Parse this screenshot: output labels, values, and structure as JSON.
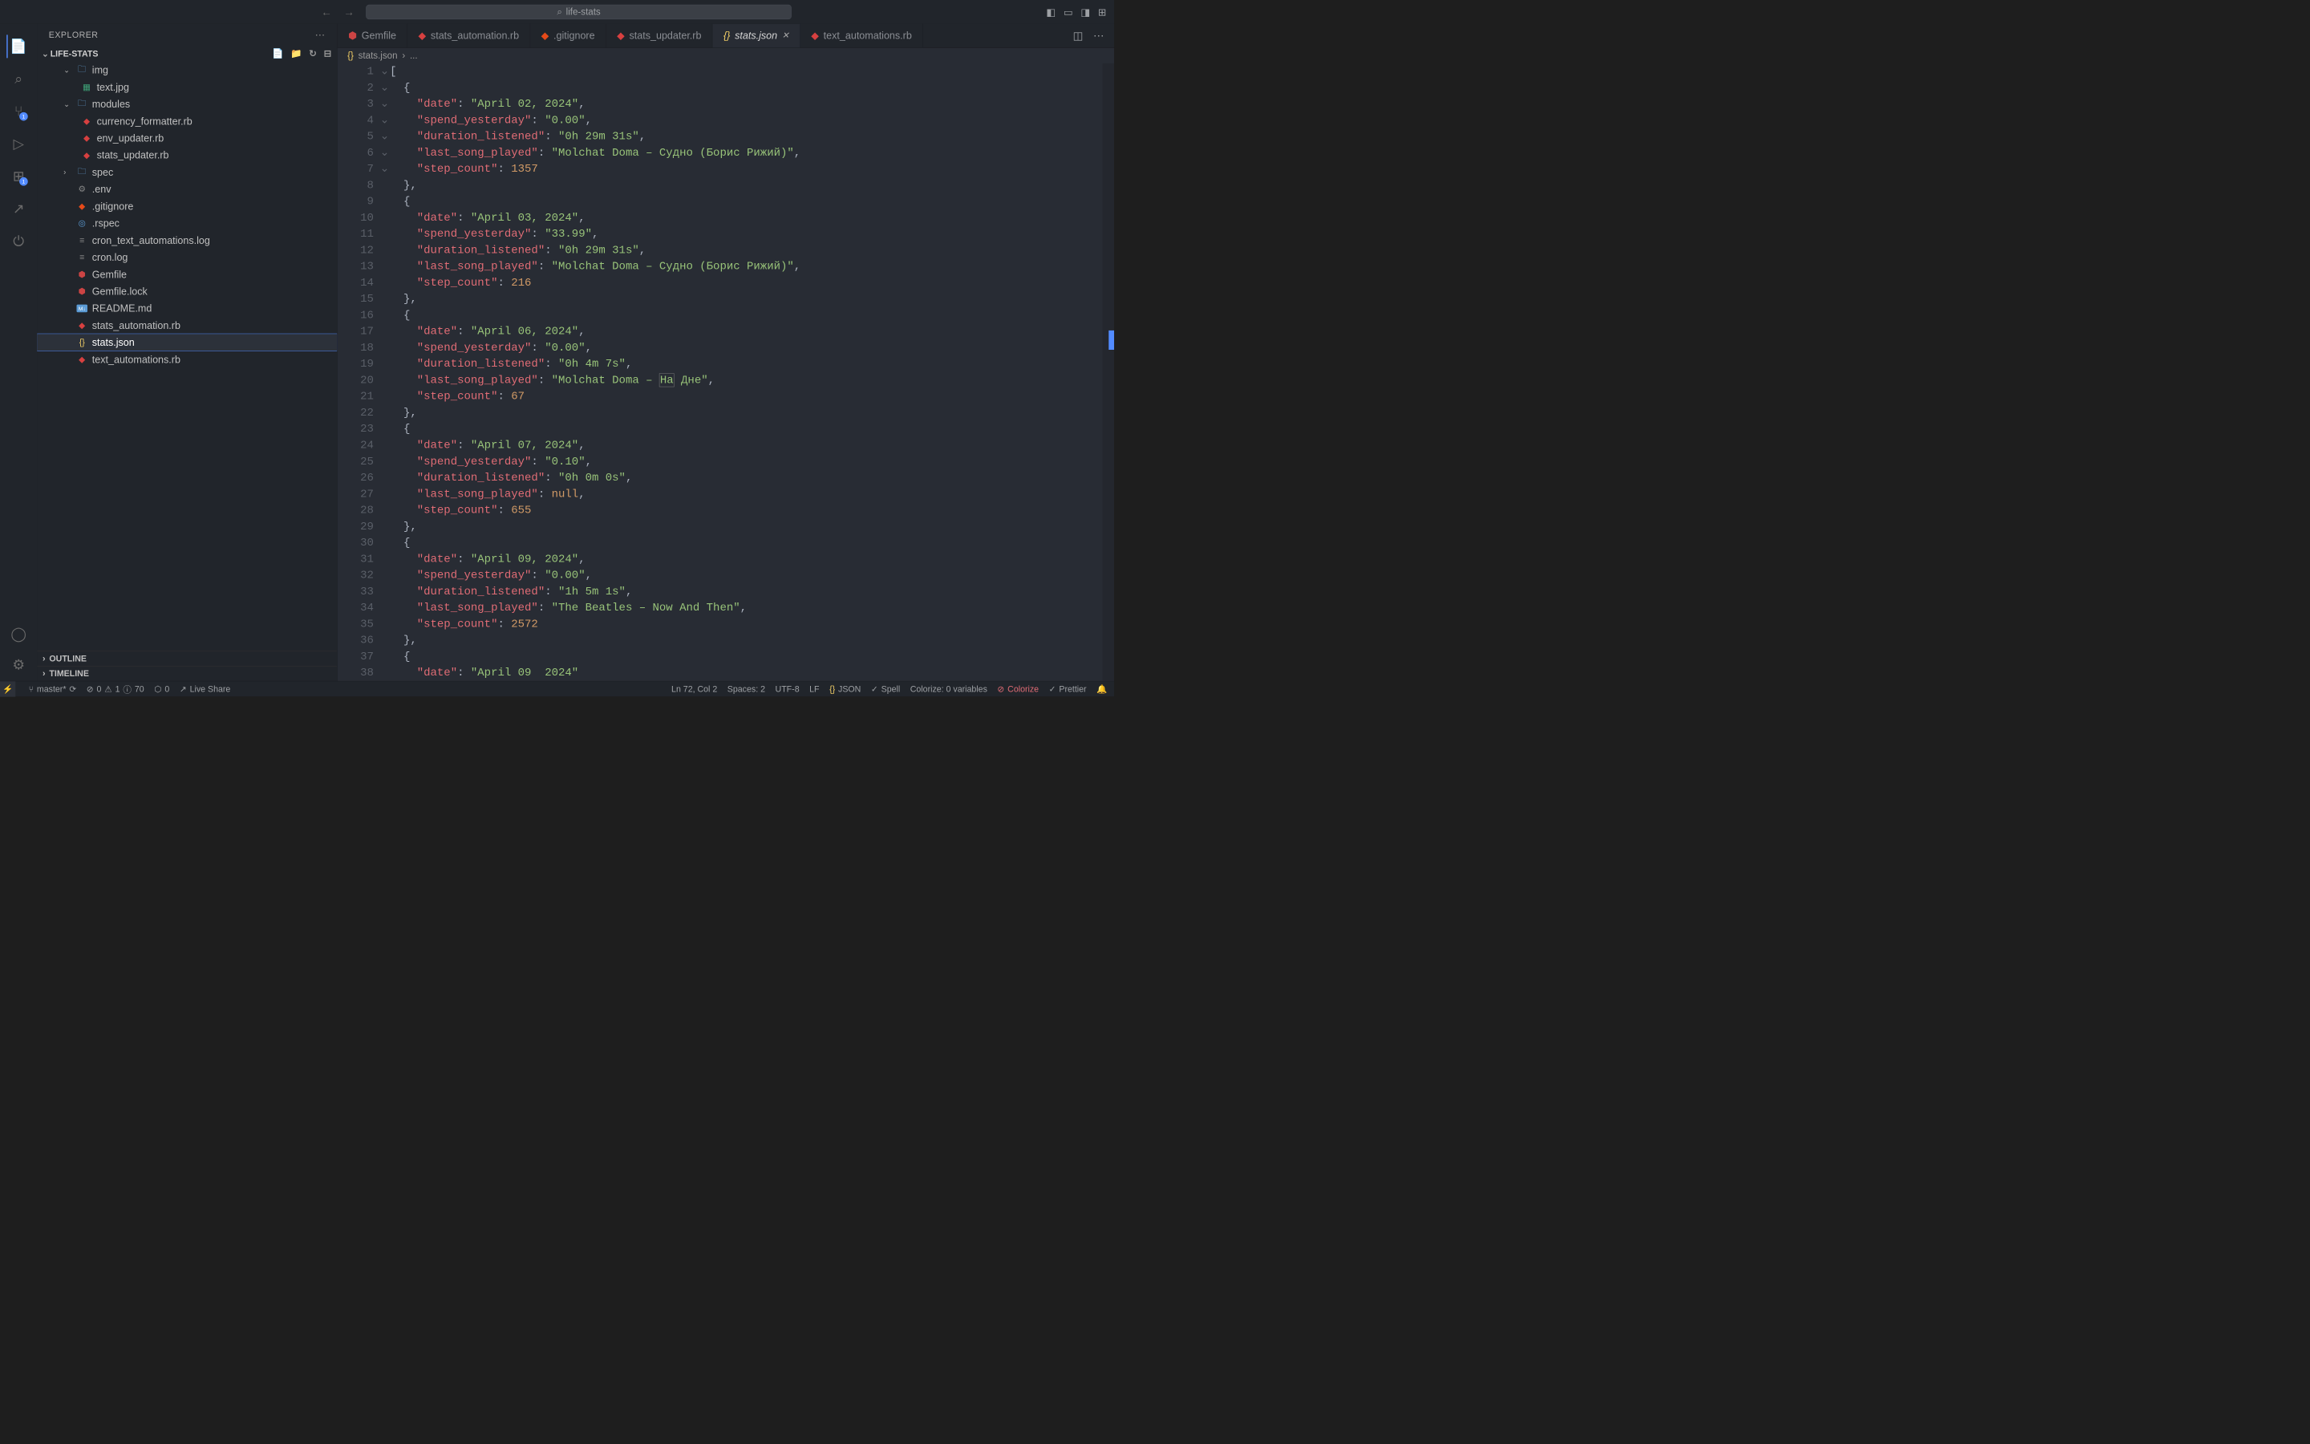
{
  "title": "life-stats",
  "explorer_label": "EXPLORER",
  "project_name": "LIFE-STATS",
  "outline_label": "OUTLINE",
  "timeline_label": "TIMELINE",
  "tree": {
    "img": "img",
    "text_jpg": "text.jpg",
    "modules": "modules",
    "currency_formatter": "currency_formatter.rb",
    "env_updater": "env_updater.rb",
    "stats_updater_mod": "stats_updater.rb",
    "spec": "spec",
    "env": ".env",
    "gitignore": ".gitignore",
    "rspec": ".rspec",
    "cron_text": "cron_text_automations.log",
    "cron_log": "cron.log",
    "gemfile": "Gemfile",
    "gemfile_lock": "Gemfile.lock",
    "readme": "README.md",
    "stats_automation": "stats_automation.rb",
    "stats_json": "stats.json",
    "text_automations": "text_automations.rb"
  },
  "tabs": {
    "gemfile": "Gemfile",
    "stats_automation": "stats_automation.rb",
    "gitignore": ".gitignore",
    "stats_updater": "stats_updater.rb",
    "stats_json": "stats.json",
    "text_automations": "text_automations.rb"
  },
  "breadcrumb": {
    "file": "stats.json",
    "rest": "..."
  },
  "badges": {
    "scm": "1",
    "ext": "1"
  },
  "code": {
    "k_date": "\"date\"",
    "k_spend": "\"spend_yesterday\"",
    "k_dur": "\"duration_listened\"",
    "k_last": "\"last_song_played\"",
    "k_step": "\"step_count\"",
    "d1": "\"April 02, 2024\"",
    "sp1": "\"0.00\"",
    "du1": "\"0h 29m 31s\"",
    "ls1": "\"Molchat Doma – Судно (Борис Рижий)\"",
    "st1": "1357",
    "d2": "\"April 03, 2024\"",
    "sp2": "\"33.99\"",
    "du2": "\"0h 29m 31s\"",
    "ls2": "\"Molchat Doma – Судно (Борис Рижий)\"",
    "st2": "216",
    "d3": "\"April 06, 2024\"",
    "sp3": "\"0.00\"",
    "du3": "\"0h 4m 7s\"",
    "ls3a": "\"Molchat Doma – ",
    "ls3cur": "На",
    "ls3b": " Дне\"",
    "st3": "67",
    "d4": "\"April 07, 2024\"",
    "sp4": "\"0.10\"",
    "du4": "\"0h 0m 0s\"",
    "ls4": "null",
    "st4": "655",
    "d5": "\"April 09, 2024\"",
    "sp5": "\"0.00\"",
    "du5": "\"1h 5m 1s\"",
    "ls5": "\"The Beatles – Now And Then\"",
    "st5": "2572",
    "d6": "\"April 09  2024\""
  },
  "status": {
    "branch": "master*",
    "sync": "⟳",
    "err": "0",
    "warn": "1",
    "info": "70",
    "hints": "0",
    "live": "Live Share",
    "pos": "Ln 72, Col 2",
    "spaces": "Spaces: 2",
    "enc": "UTF-8",
    "eol": "LF",
    "lang": "JSON",
    "spell": "Spell",
    "colorize_vars": "Colorize: 0 variables",
    "colorize": "Colorize",
    "prettier": "Prettier"
  }
}
